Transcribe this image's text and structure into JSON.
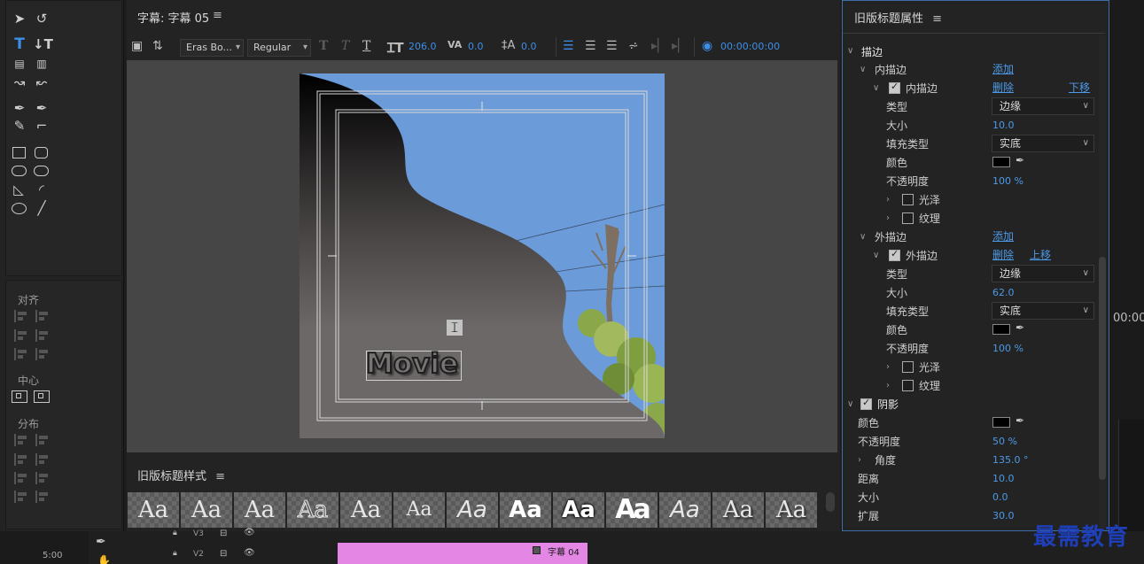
{
  "title_panel": {
    "header": "字幕: 字幕 05",
    "menu_glyph": "≡",
    "font_family": "Eras Bo...",
    "font_style": "Regular",
    "font_size": "206.0",
    "kerning": "0.0",
    "leading": "0.0",
    "timecode": "00:00:00:00",
    "canvas_text": "Movie"
  },
  "tools": {
    "align_label": "对齐",
    "center_label": "中心",
    "distribute_label": "分布",
    "active_tool": "type-tool"
  },
  "styles_panel": {
    "title": "旧版标题样式",
    "menu_glyph": "≡",
    "swatches": [
      "Aa",
      "Aa",
      "Aa",
      "Aa",
      "Aa",
      "Aa",
      "Aa",
      "Aa",
      "Aa",
      "Aa",
      "Aa",
      "Aa",
      "Aa"
    ]
  },
  "props": {
    "title": "旧版标题属性",
    "menu_glyph": "≡",
    "stroke_section": "描边",
    "inner_strokes_label": "内描边",
    "add_label": "添加",
    "inner_stroke_item": "内描边",
    "delete_label": "删除",
    "move_down_label": "下移",
    "type_label": "类型",
    "type_value": "边缘",
    "size_label": "大小",
    "inner_size": "10.0",
    "fill_type_label": "填充类型",
    "fill_type_value": "实底",
    "color_label": "颜色",
    "opacity_label": "不透明度",
    "inner_opacity": "100 %",
    "sheen_label": "光泽",
    "texture_label": "纹理",
    "outer_strokes_label": "外描边",
    "add_label2": "添加",
    "outer_stroke_item": "外描边",
    "delete_label2": "删除",
    "move_up_label": "上移",
    "outer_type_value": "边缘",
    "outer_size": "62.0",
    "outer_fill_type": "实底",
    "outer_opacity": "100 %",
    "shadow_section": "阴影",
    "shadow_color_label": "颜色",
    "shadow_opacity_label": "不透明度",
    "shadow_opacity": "50 %",
    "angle_label": "角度",
    "shadow_angle": "135.0 °",
    "distance_label": "距离",
    "shadow_distance": "10.0",
    "shadow_size_label": "大小",
    "shadow_size": "0.0",
    "spread_label": "扩展",
    "shadow_spread": "30.0"
  },
  "timeline": {
    "track_v3": "V3",
    "track_v2": "V2",
    "clip_label": "字幕 04",
    "time_left": "5:00",
    "time_right": "00:00"
  },
  "watermark": "最需教育",
  "colors": {
    "accent": "#4c9ae8",
    "clip": "#e487e4",
    "panel": "#232323"
  }
}
